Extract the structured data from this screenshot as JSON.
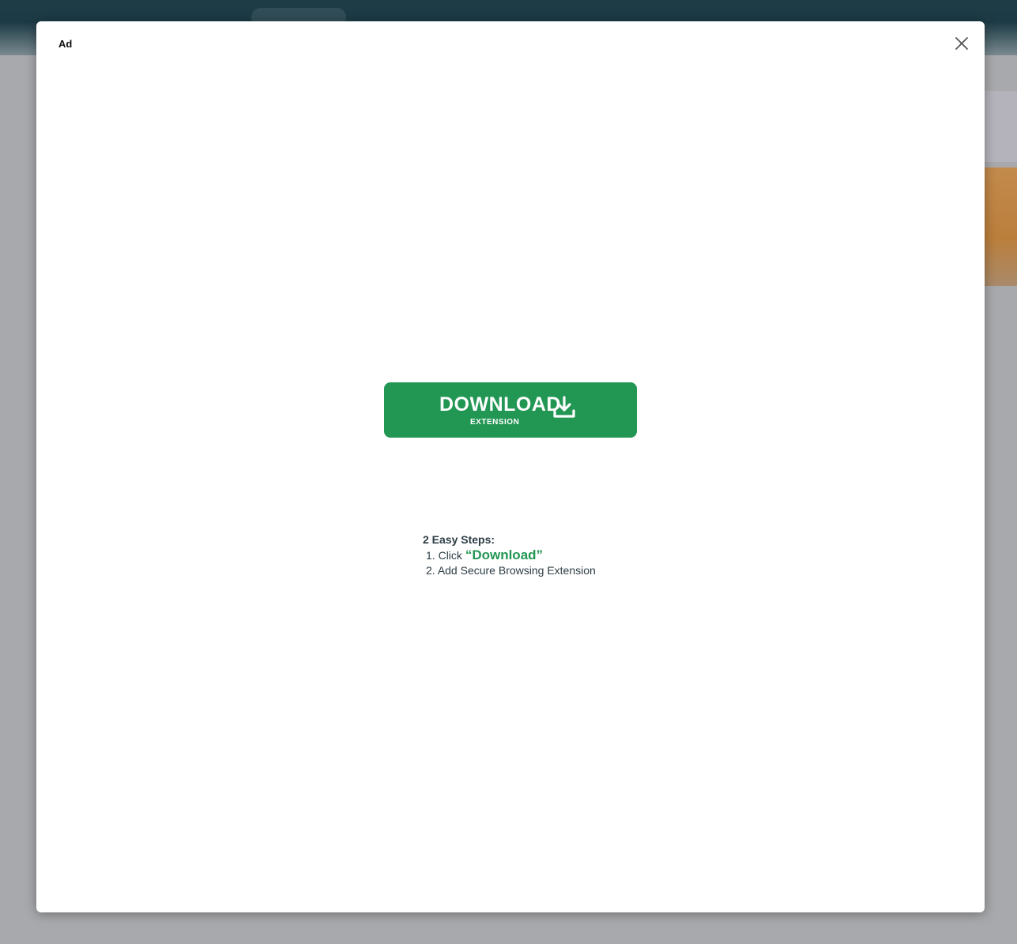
{
  "ad": {
    "label": "Ad",
    "close_icon": "close-icon"
  },
  "download_button": {
    "label": "DOWNLOAD",
    "sublabel": "EXTENSION",
    "icon": "download-icon",
    "color": "#229653"
  },
  "steps": {
    "title": "2 Easy Steps:",
    "step1_number": "1.",
    "step1_prefix": "Click",
    "step1_highlight": "“Download”",
    "step2_number": "2.",
    "step2_text": "Add Secure Browsing Extension"
  }
}
